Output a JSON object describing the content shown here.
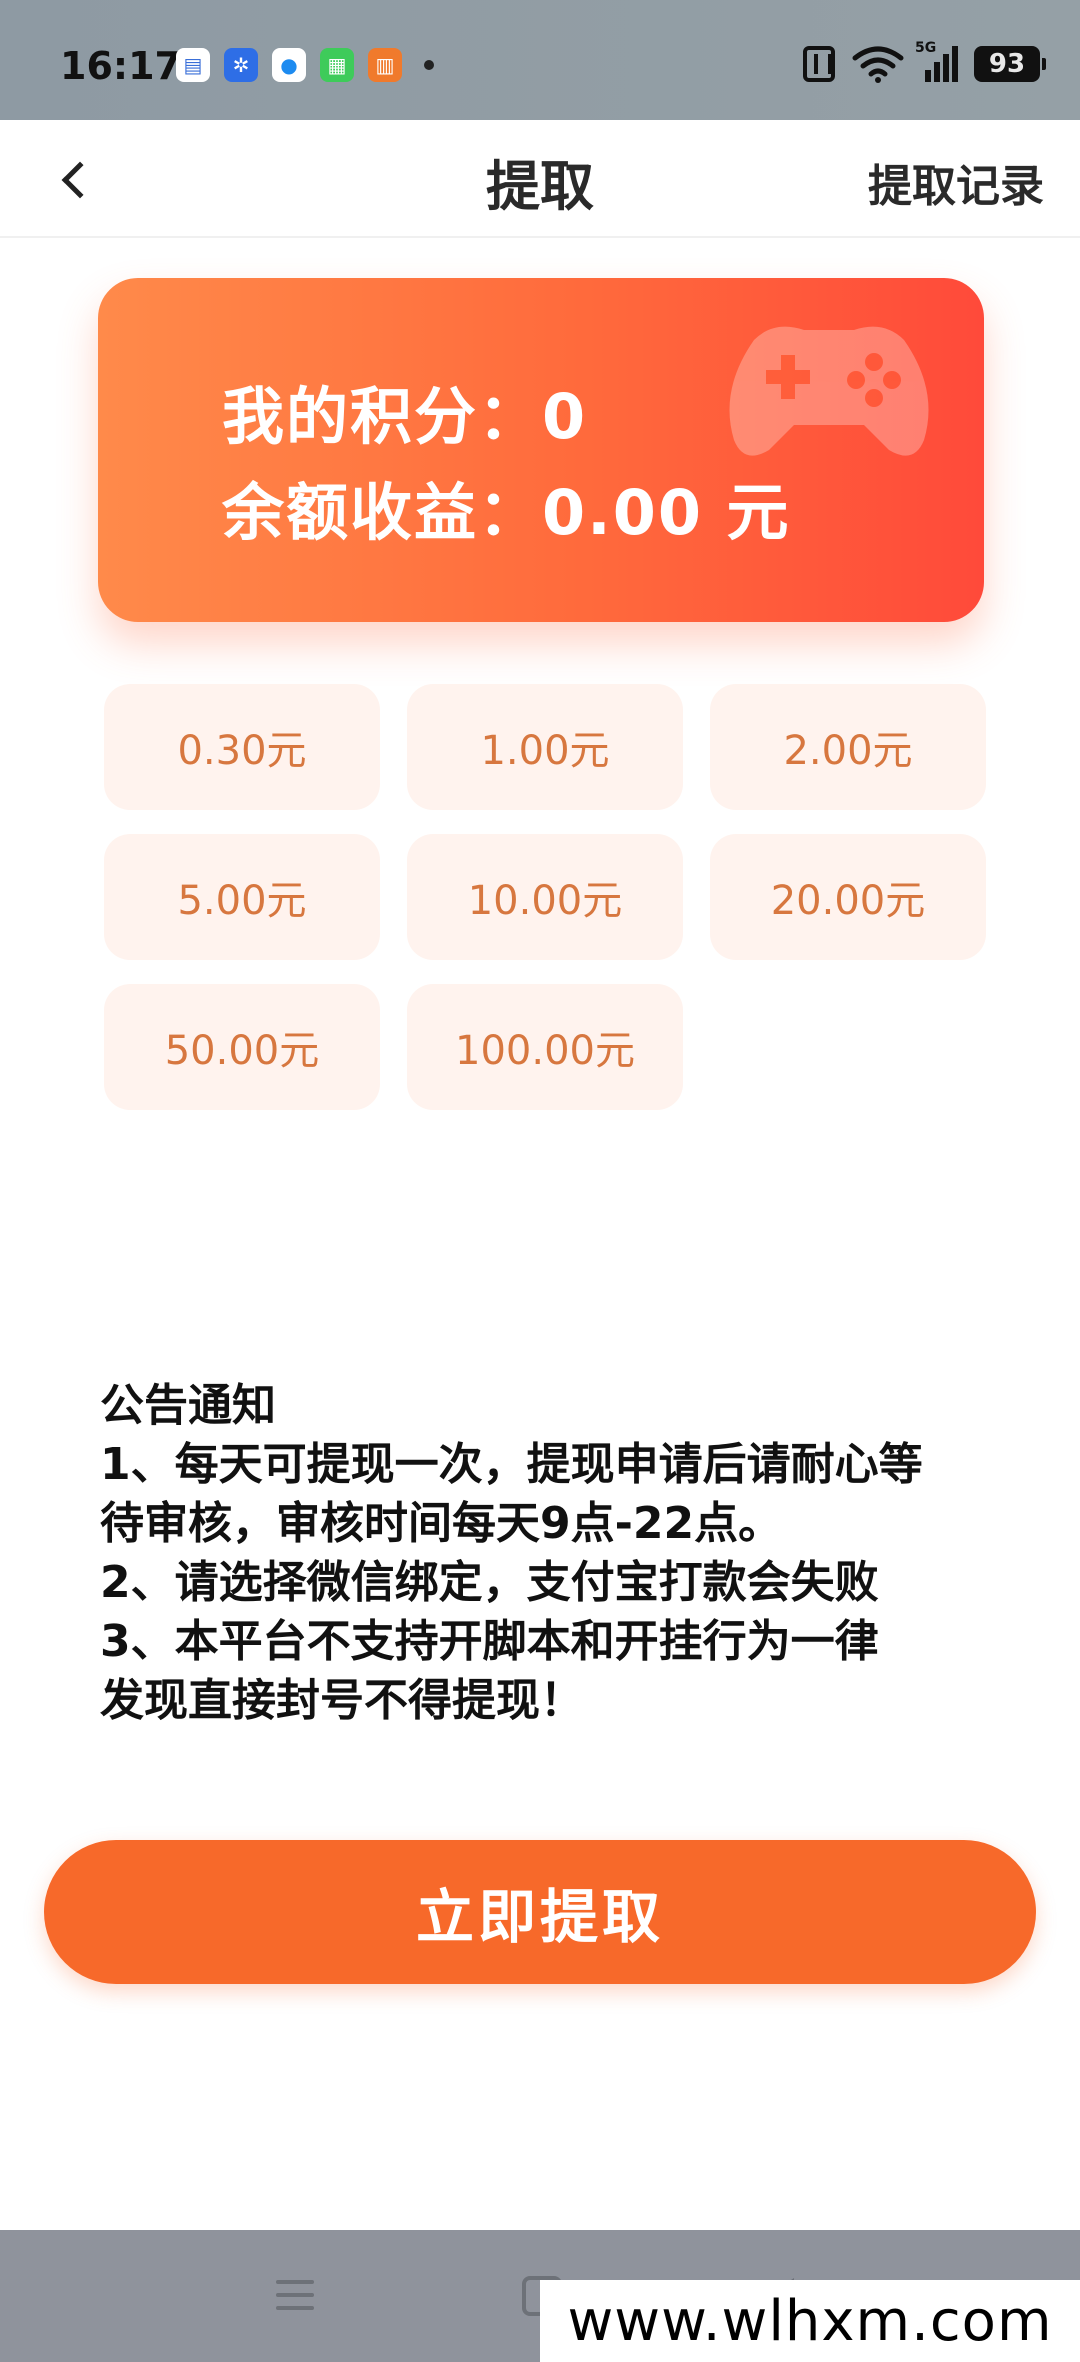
{
  "status_bar": {
    "time": "16:17",
    "app_icons": [
      "messages-icon",
      "pinwheel-icon",
      "circle-app-icon",
      "green-app-icon",
      "book-app-icon"
    ],
    "network": "5G",
    "battery": "93"
  },
  "header": {
    "title": "提取",
    "right_link": "提取记录"
  },
  "balance": {
    "points_line": "我的积分：0",
    "earnings_line": "余额收益：0.00 元"
  },
  "amounts": [
    "0.30元",
    "1.00元",
    "2.00元",
    "5.00元",
    "10.00元",
    "20.00元",
    "50.00元",
    "100.00元"
  ],
  "notice": {
    "lines": [
      "公告通知",
      "1、每天可提现一次，提现申请后请耐心等",
      "待审核，审核时间每天9点-22点。",
      "2、请选择微信绑定，支付宝打款会失败",
      "3、本平台不支持开脚本和开挂行为一律",
      "发现直接封号不得提现！"
    ]
  },
  "submit_label": "立即提取",
  "watermark": "www.wlhxm.com",
  "colors": {
    "accent": "#f7692a",
    "card_start": "#ff8a4a",
    "card_end": "#ff4a3a",
    "option_bg": "#fff3ee",
    "option_text": "#d7773f"
  }
}
